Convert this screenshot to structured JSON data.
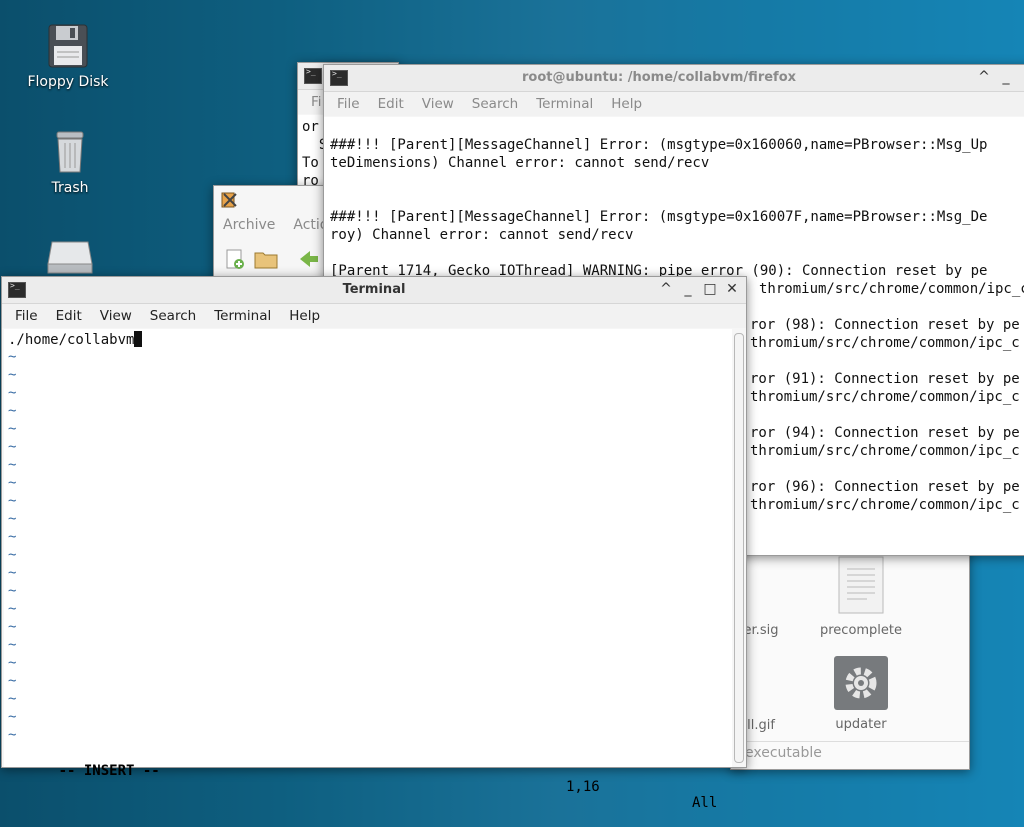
{
  "desktop": {
    "icons": [
      {
        "label": "Floppy Disk",
        "icon": "floppy-icon"
      },
      {
        "label": "Trash",
        "icon": "trash-icon"
      },
      {
        "label": "",
        "icon": "drive-icon"
      }
    ]
  },
  "back_terminal": {
    "menu_first": "Fi",
    "lines": [
      "or",
      "  S",
      "To",
      "ro"
    ]
  },
  "archive": {
    "toolbar": [
      "Archive",
      "Actio"
    ]
  },
  "file_manager": {
    "items": [
      "er.sig",
      "precomplete",
      "ll.gif",
      "updater"
    ],
    "status": "executable"
  },
  "firefox_terminal": {
    "title": "root@ubuntu: /home/collabvm/firefox",
    "menu": [
      "File",
      "Edit",
      "View",
      "Search",
      "Terminal",
      "Help"
    ],
    "lines": [
      "###!!! [Parent][MessageChannel] Error: (msgtype=0x160060,name=PBrowser::Msg_Up",
      "teDimensions) Channel error: cannot send/recv",
      "",
      "",
      "###!!! [Parent][MessageChannel] Error: (msgtype=0x16007F,name=PBrowser::Msg_De",
      "roy) Channel error: cannot send/recv",
      "",
      "[Parent 1714, Gecko_IOThread] WARNING: pipe error (90): Connection reset by pe",
      "thromium/src/chrome/common/ipc_c",
      "",
      "ror (98): Connection reset by pe",
      "thromium/src/chrome/common/ipc_c",
      "",
      "ror (91): Connection reset by pe",
      "thromium/src/chrome/common/ipc_c",
      "",
      "ror (94): Connection reset by pe",
      "thromium/src/chrome/common/ipc_c",
      "",
      "ror (96): Connection reset by pe",
      "thromium/src/chrome/common/ipc_c"
    ]
  },
  "main_terminal": {
    "title": "Terminal",
    "menu": [
      "File",
      "Edit",
      "View",
      "Search",
      "Terminal",
      "Help"
    ],
    "buffer_line": "./home/collabvm",
    "tilde": "~",
    "mode": "-- INSERT --",
    "position": "1,16",
    "scroll_pos": "All"
  },
  "window_controls": {
    "up": "^",
    "minimize": "_",
    "maximize": "□",
    "close": "✕"
  }
}
